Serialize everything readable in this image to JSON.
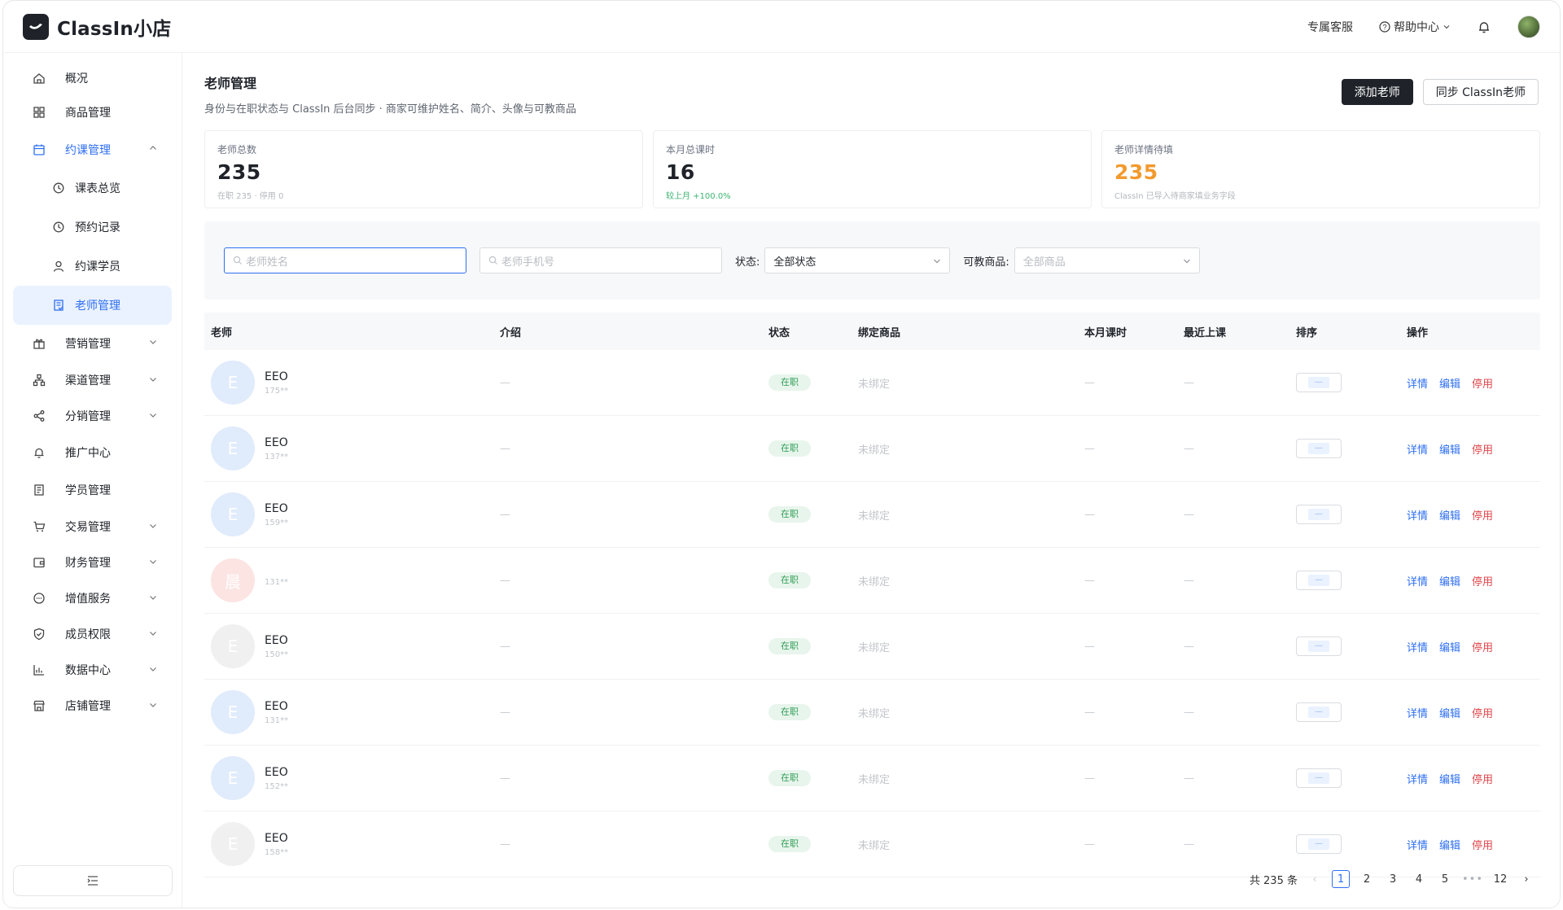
{
  "header": {
    "logo_text": "ClassIn小店",
    "service": "专属客服",
    "help": "帮助中心"
  },
  "sidebar": {
    "items": [
      {
        "label": "概况",
        "icon": "home-icon"
      },
      {
        "label": "商品管理",
        "icon": "grid-icon"
      },
      {
        "label": "约课管理",
        "icon": "calendar-icon"
      },
      {
        "label": "课表总览",
        "icon": "clock-icon"
      },
      {
        "label": "预约记录",
        "icon": "clock-icon"
      },
      {
        "label": "约课学员",
        "icon": "user-icon"
      },
      {
        "label": "老师管理",
        "icon": "teacher-icon"
      },
      {
        "label": "营销管理",
        "icon": "gift-icon"
      },
      {
        "label": "渠道管理",
        "icon": "channel-icon"
      },
      {
        "label": "分销管理",
        "icon": "share-icon"
      },
      {
        "label": "推广中心",
        "icon": "bell-icon"
      },
      {
        "label": "学员管理",
        "icon": "student-icon"
      },
      {
        "label": "交易管理",
        "icon": "cart-icon"
      },
      {
        "label": "财务管理",
        "icon": "wallet-icon"
      },
      {
        "label": "增值服务",
        "icon": "chat-icon"
      },
      {
        "label": "成员权限",
        "icon": "shield-icon"
      },
      {
        "label": "数据中心",
        "icon": "chart-icon"
      },
      {
        "label": "店铺管理",
        "icon": "store-icon"
      }
    ]
  },
  "page": {
    "title": "老师管理",
    "subtitle": "身份与在职状态与 ClassIn 后台同步 · 商家可维护姓名、简介、头像与可教商品",
    "add_button": "添加老师",
    "sync_button": "同步 ClassIn老师"
  },
  "stats": [
    {
      "label": "老师总数",
      "value": "235",
      "note": "在职 235 · 停用 0"
    },
    {
      "label": "本月总课时",
      "value": "16",
      "note": "较上月 +100.0%"
    },
    {
      "label": "老师详情待填",
      "value": "235",
      "note": "ClassIn 已导入待商家填业务字段"
    }
  ],
  "filters": {
    "name_placeholder": "老师姓名",
    "phone_placeholder": "老师手机号",
    "status_label": "状态:",
    "status_value": "全部状态",
    "goods_label": "可教商品:",
    "goods_placeholder": "全部商品"
  },
  "table": {
    "headers": [
      "老师",
      "介绍",
      "状态",
      "绑定商品",
      "本月课时",
      "最近上课",
      "排序",
      "操作"
    ],
    "rows": [
      {
        "initial": "E",
        "name": "EEO",
        "phone": "175**",
        "color": "#dbe8fb"
      },
      {
        "initial": "E",
        "name": "EEO",
        "phone": "137**",
        "color": "#dbe8fb"
      },
      {
        "initial": "E",
        "name": "EEO",
        "phone": "159**",
        "color": "#dbe8fb"
      },
      {
        "initial": "晨",
        "name": "",
        "phone": "131**",
        "color": "#fbe0de"
      },
      {
        "initial": "E",
        "name": "EEO",
        "phone": "150**",
        "color": "#eeeeef"
      },
      {
        "initial": "E",
        "name": "EEO",
        "phone": "131**",
        "color": "#dbe8fb"
      },
      {
        "initial": "E",
        "name": "EEO",
        "phone": "152**",
        "color": "#dbe8fb"
      },
      {
        "initial": "E",
        "name": "EEO",
        "phone": "158**",
        "color": "#eeeeef"
      }
    ],
    "dash": "—",
    "status_tag": "在职",
    "unbound": "未绑定",
    "sort_value": "—",
    "op_detail": "详情",
    "op_edit": "编辑",
    "op_disable": "停用"
  },
  "pagination": {
    "total": "共 235 条",
    "pages": [
      "1",
      "2",
      "3",
      "4",
      "5"
    ],
    "ellipsis": "•••",
    "last": "12"
  }
}
